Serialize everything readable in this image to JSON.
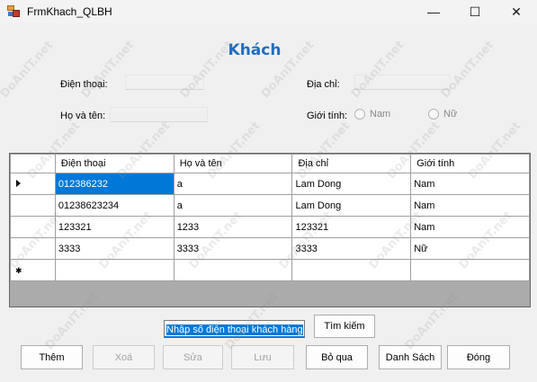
{
  "window": {
    "title": "FrmKhach_QLBH",
    "minimize_glyph": "—",
    "maximize_glyph": "☐",
    "close_glyph": "✕"
  },
  "form": {
    "heading": "Khách",
    "phone_label": "Điện thoại:",
    "phone_value": "",
    "address_label": "Địa chỉ:",
    "address_value": "",
    "name_label": "Họ và tên:",
    "name_value": "",
    "gender_label": "Giới tính:",
    "gender_male": "Nam",
    "gender_female": "Nữ"
  },
  "grid": {
    "columns": [
      "Điện thoại",
      "Họ và tên",
      "Địa chỉ",
      "Giới tính"
    ],
    "rows": [
      [
        "012386232",
        "a",
        "Lam Dong",
        "Nam"
      ],
      [
        "01238623234",
        "a",
        "Lam Dong",
        "Nam"
      ],
      [
        "123321",
        "1233",
        "123321",
        "Nam"
      ],
      [
        "3333",
        "3333",
        "3333",
        "Nữ"
      ]
    ],
    "new_row_marker": "✱"
  },
  "search": {
    "value": "Nhập số điện thoại khách hàng",
    "button_label": "Tìm kiếm"
  },
  "buttons": {
    "add": "Thêm",
    "delete": "Xoá",
    "edit": "Sửa",
    "save": "Lưu",
    "skip": "Bỏ qua",
    "list": "Danh Sách",
    "close": "Đóng"
  },
  "watermark": "DoAnIT.net",
  "colors": {
    "heading": "#1e6fbf",
    "selection": "#0078d7",
    "grid_empty_area": "#ababab"
  }
}
